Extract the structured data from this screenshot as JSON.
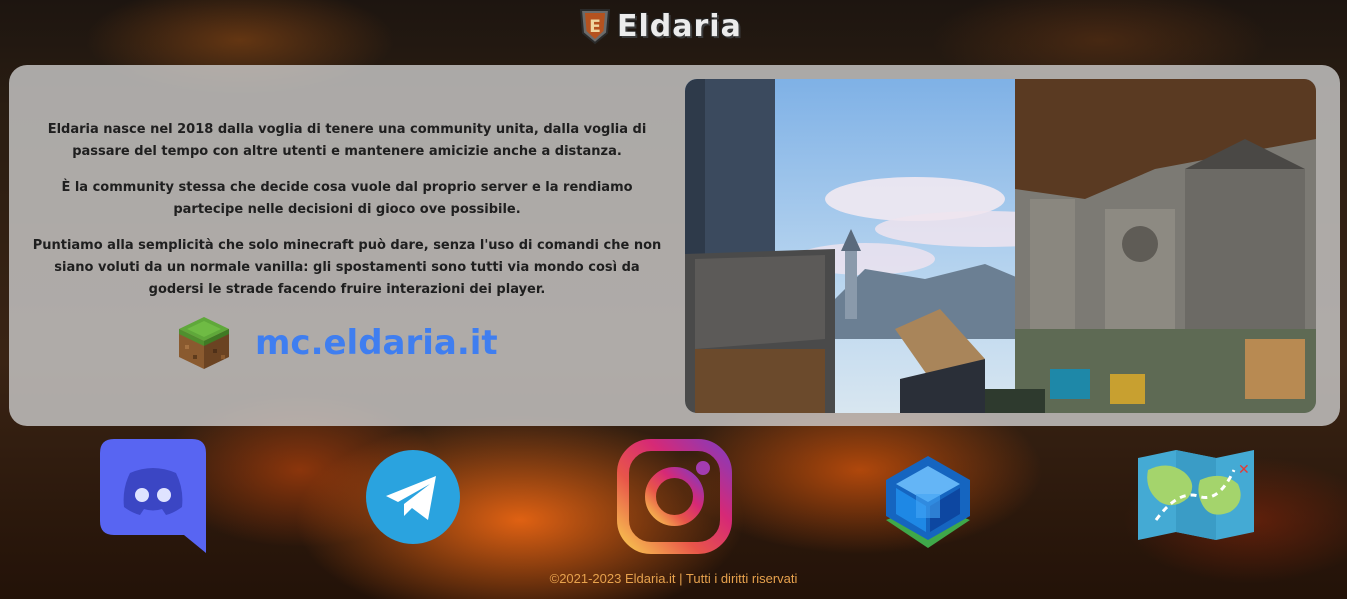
{
  "brand": {
    "name": "Eldaria",
    "shield_letter": "E"
  },
  "about": {
    "paragraphs": [
      "Eldaria nasce nel 2018 dalla voglia di tenere una community unita, dalla voglia di passare del tempo con altre utenti e mantenere amicizie anche a distanza.",
      "È la community stessa che decide cosa vuole dal proprio server e la rendiamo partecipe nelle decisioni di gioco ove possibile.",
      "Puntiamo alla semplicità che solo minecraft può dare, senza l'uso di comandi che non siano voluti da un normale vanilla: gli spostamenti sono tutti via mondo così da godersi le strade facendo fruire interazioni dei player."
    ]
  },
  "server": {
    "address": "mc.eldaria.it",
    "icon": "grass-block-icon"
  },
  "social": [
    {
      "name": "discord",
      "icon": "discord-icon",
      "color": "#5865F2"
    },
    {
      "name": "telegram",
      "icon": "telegram-icon",
      "color": "#2AA3DF"
    },
    {
      "name": "instagram",
      "icon": "instagram-icon",
      "color": "#D62976"
    },
    {
      "name": "store",
      "icon": "cube-icon",
      "color": "#1E88E5"
    },
    {
      "name": "map",
      "icon": "map-icon",
      "color": "#44AAD4"
    }
  ],
  "footer": {
    "text": "©2021-2023 Eldaria.it | Tutti i diritti riservati"
  },
  "colors": {
    "accent": "#3f7ef0",
    "footer": "#e7a24d",
    "panel": "#cdcdcd"
  }
}
